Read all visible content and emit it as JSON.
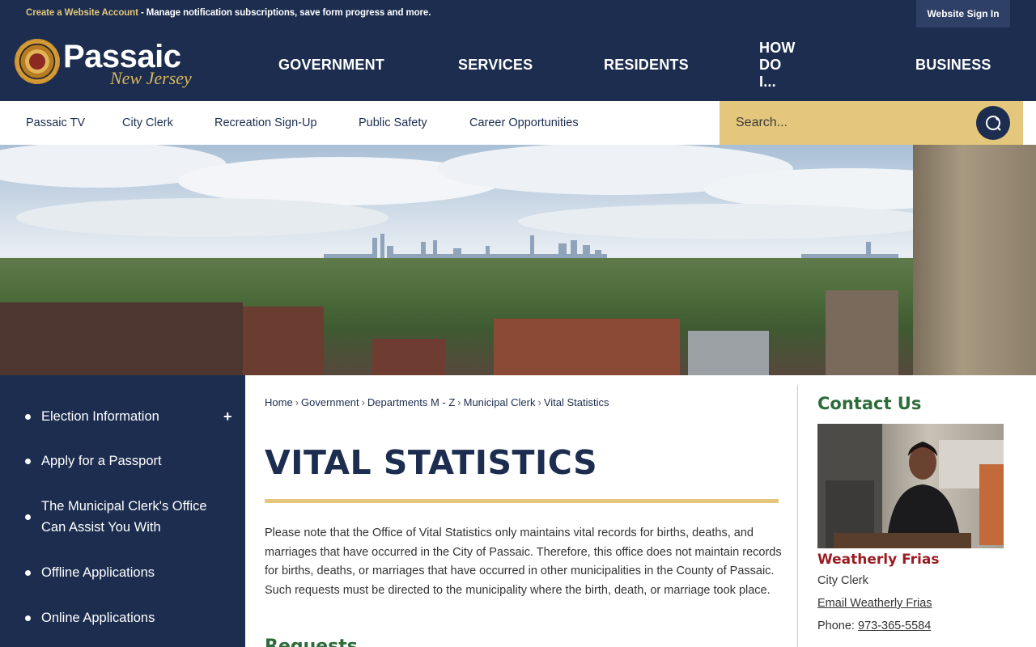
{
  "topbar": {
    "create_account": "Create a Website Account",
    "message": " - Manage notification subscriptions, save form progress and more.",
    "sign_in": "Website Sign In"
  },
  "logo": {
    "name": "Passaic",
    "script": "New Jersey"
  },
  "main_nav": [
    "GOVERNMENT",
    "SERVICES",
    "RESIDENTS",
    "HOW DO I...",
    "BUSINESS"
  ],
  "quick_links": [
    "Passaic TV",
    "City Clerk",
    "Recreation Sign-Up",
    "Public Safety",
    "Career Opportunities"
  ],
  "search": {
    "placeholder": "Search...",
    "icon": "search-icon"
  },
  "sidebar": {
    "items": [
      {
        "label": "Election Information",
        "expandable": true
      },
      {
        "label": "Apply for a Passport"
      },
      {
        "label": "The Municipal Clerk's Office Can Assist You With"
      },
      {
        "label": "Offline Applications"
      },
      {
        "label": "Online Applications"
      }
    ],
    "expand_symbol": "+"
  },
  "breadcrumb": [
    "Home",
    "Government",
    "Departments M - Z",
    "Municipal Clerk",
    "Vital Statistics"
  ],
  "breadcrumb_sep": "›",
  "page": {
    "title": "VITAL STATISTICS",
    "paragraph": "Please note that the Office of Vital Statistics only maintains vital records for births, deaths, and marriages that have occurred in the City of Passaic. Therefore, this office does not maintain records for births, deaths, or marriages that have occurred in other municipalities in the County of Passaic. Such requests must be directed to the municipality where the birth, death, or marriage took place.",
    "subheading": "Requests"
  },
  "contact": {
    "heading": "Contact Us",
    "name": "Weatherly Frias",
    "role": "City Clerk",
    "email_link": "Email Weatherly Frias",
    "phone_label": "Phone: ",
    "phone": "973-365-5584"
  },
  "colors": {
    "navy": "#1c2d4f",
    "gold": "#e4c77c",
    "green": "#2e6b3a",
    "red": "#9b1b22"
  }
}
